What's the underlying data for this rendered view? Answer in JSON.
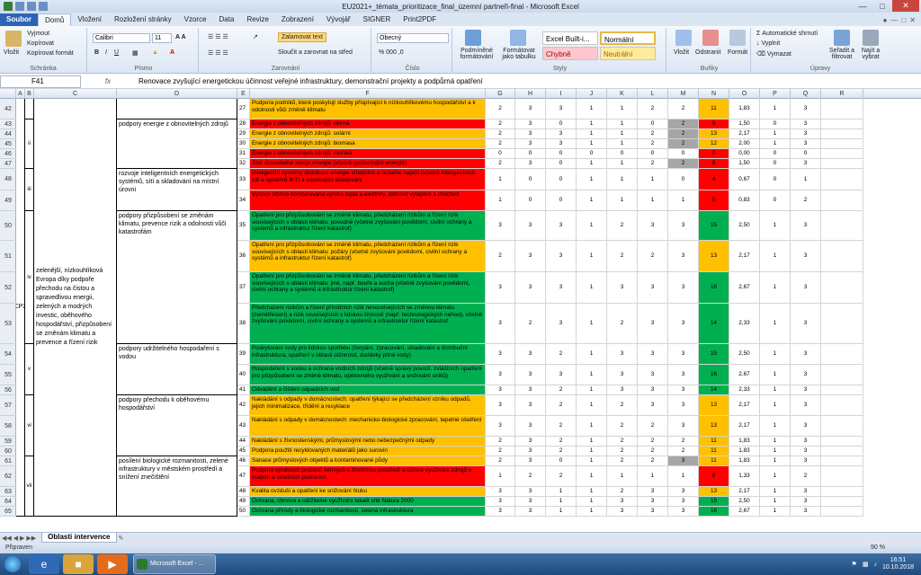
{
  "window": {
    "title": "EU2021+_témata_prioritizace_final_územní partneři-final  -  Microsoft Excel",
    "controls": [
      "minimize",
      "maximize",
      "close"
    ]
  },
  "ribbon_tabs": [
    "Soubor",
    "Domů",
    "Vložení",
    "Rozložení stránky",
    "Vzorce",
    "Data",
    "Revize",
    "Zobrazení",
    "Vývojář",
    "SIGNER",
    "Print2PDF"
  ],
  "ribbon": {
    "clipboard": {
      "paste": "Vložit",
      "cut": "Vyjmout",
      "copy": "Kopírovat",
      "format_painter": "Kopírovat formát",
      "label": "Schránka"
    },
    "font": {
      "name": "Calibri",
      "size": "11",
      "label": "Písmo"
    },
    "alignment": {
      "wrap": "Zalamovat text",
      "merge": "Sloučit a zarovnat na střed",
      "label": "Zarovnání"
    },
    "number": {
      "format": "Obecný",
      "label": "Číslo"
    },
    "styles": {
      "cond_format": "Podmíněné formátování",
      "as_table": "Formátovat jako tabulku",
      "builtin": "Excel Built-i...",
      "normal": "Normální",
      "bad": "Chybně",
      "neutral": "Neutrální",
      "label": "Styly"
    },
    "cells": {
      "insert": "Vložit",
      "delete": "Odstranit",
      "format": "Formát",
      "label": "Buňky"
    },
    "editing": {
      "autosum": "Automatické shrnutí",
      "fill": "Vyplnit",
      "clear": "Vymazat",
      "sort": "Seřadit a filtrovat",
      "find": "Najít a vybrat",
      "label": "Úpravy"
    }
  },
  "formula_bar": {
    "name_box": "F41",
    "fx": "fx",
    "content": "Renovace zvyšující energetickou účinnost veřejné infrastruktury, demonstrační projekty a podpůrná opatření"
  },
  "columns": [
    "A",
    "B",
    "C",
    "D",
    "E",
    "F",
    "G",
    "H",
    "I",
    "J",
    "K",
    "L",
    "M",
    "N",
    "O",
    "P",
    "Q",
    "R"
  ],
  "colors": {
    "green": "#00b050",
    "orange": "#ffc000",
    "red": "#ff0000",
    "grey": "#a6a6a6"
  },
  "merged_labels": {
    "cp": "CP2",
    "b_ii": "ii",
    "b_iii": "iii",
    "b_iv": "iv",
    "b_v": "v",
    "b_vi": "vi",
    "b_vii": "vii",
    "c_text": "zelenější, nízkouhlíková Evropa díky podpoře přechodu na čistou a spravedlivou energii, zelených a modrých investic, oběhového hospodářství, přizpůsobení se změnám klimatu a prevence a řízení rizik",
    "d_ii": "podpory energie z obnovitelných zdrojů",
    "d_iii": "rozvoje inteligentních energetických systémů, sítí a skladování na místní úrovni",
    "d_iv": "podpory přizpůsobení se změnám klimatu, prevence rizik a odolnosti vůči katastrofám",
    "d_v": "podpory udržitelného hospodaření s vodou",
    "d_vi": "podpory přechodu k oběhovému hospodářství",
    "d_vii": "posílení biologické rozmanitosti, zelené infrastruktury v městském prostředí a snížení znečištění"
  },
  "rows": [
    {
      "row": "42",
      "e": "27",
      "f": "Podpora podniků, které poskytují služby přispívající k nízkouhlíkovému hospodářství a k odolnosti vůči změně klimatu",
      "g": "2",
      "h": "3",
      "i": "3",
      "j": "1",
      "k": "1",
      "l": "2",
      "m": "2",
      "n": "11",
      "o": "1,83",
      "p": "1",
      "q": "3",
      "color": "orange",
      "mgrey": false
    },
    {
      "row": "43",
      "e": "28",
      "f": "Energie z obnovitelných zdrojů: větrná",
      "g": "2",
      "h": "3",
      "i": "0",
      "j": "1",
      "k": "1",
      "l": "0",
      "m": "2",
      "n": "9",
      "o": "1,50",
      "p": "0",
      "q": "3",
      "color": "red",
      "mgrey": true
    },
    {
      "row": "44",
      "e": "29",
      "f": "Energie z obnovitelných zdrojů: solární",
      "g": "2",
      "h": "3",
      "i": "3",
      "j": "1",
      "k": "1",
      "l": "2",
      "m": "2",
      "n": "13",
      "o": "2,17",
      "p": "1",
      "q": "3",
      "color": "orange",
      "mgrey": true
    },
    {
      "row": "45",
      "e": "30",
      "f": "Energie z obnovitelných zdrojů: biomasa",
      "g": "2",
      "h": "3",
      "i": "3",
      "j": "1",
      "k": "1",
      "l": "2",
      "m": "2",
      "n": "12",
      "o": "2,00",
      "p": "1",
      "q": "3",
      "color": "orange",
      "mgrey": true
    },
    {
      "row": "46",
      "e": "31",
      "f": "Energie z obnovitelných zdrojů: mořská",
      "g": "0",
      "h": "0",
      "i": "0",
      "j": "0",
      "k": "0",
      "l": "0",
      "m": "0",
      "n": "0",
      "o": "0,00",
      "p": "0",
      "q": "0",
      "color": "red",
      "mgrey": false
    },
    {
      "row": "47",
      "e": "32",
      "f": "Jiné obnovitelné zdroje energie (včetně geotermální energie)",
      "g": "2",
      "h": "3",
      "i": "0",
      "j": "1",
      "k": "1",
      "l": "2",
      "m": "2",
      "n": "9",
      "o": "1,50",
      "p": "0",
      "q": "3",
      "color": "red",
      "mgrey": true
    },
    {
      "row": "48",
      "e": "33",
      "f": "Inteligentní systémy distribuce energie středního a nízkého napětí (včetně inteligentních sítí a systémů IKT) a související skladování",
      "g": "1",
      "h": "0",
      "i": "0",
      "j": "1",
      "k": "1",
      "l": "1",
      "m": "0",
      "n": "4",
      "o": "0,67",
      "p": "0",
      "q": "1",
      "color": "red",
      "mgrey": false
    },
    {
      "row": "49",
      "e": "34",
      "f": "Vysoce účinná kombinovaná výroba tepla a elektřiny, dálkové vytápění a chlazení",
      "g": "1",
      "h": "0",
      "i": "0",
      "j": "1",
      "k": "1",
      "l": "1",
      "m": "1",
      "n": "5",
      "o": "0,83",
      "p": "0",
      "q": "2",
      "color": "red",
      "mgrey": false
    },
    {
      "row": "50",
      "e": "35",
      "f": "Opatření pro přizpůsobování se změně klimatu, předcházení rizikům a řízení rizik souvisejících s oblastí klimatu: povodně (včetně zvyšování povědomí, civilní ochrany a systémů a infrastruktur řízení katastrof)",
      "g": "3",
      "h": "3",
      "i": "3",
      "j": "1",
      "k": "2",
      "l": "3",
      "m": "3",
      "n": "15",
      "o": "2,50",
      "p": "1",
      "q": "3",
      "color": "green",
      "mgrey": false
    },
    {
      "row": "51",
      "e": "36",
      "f": "Opatření pro přizpůsobování se změně klimatu, předcházení rizikům a řízení rizik souvisejících s oblastí klimatu: požáry (včetně zvyšování povědomí, civilní ochrany a systémů a infrastruktur řízení katastrof)",
      "g": "2",
      "h": "3",
      "i": "3",
      "j": "1",
      "k": "2",
      "l": "2",
      "m": "3",
      "n": "13",
      "o": "2,17",
      "p": "1",
      "q": "3",
      "color": "orange",
      "mgrey": false
    },
    {
      "row": "52",
      "e": "37",
      "f": "Opatření pro přizpůsobování se změně klimatu, předcházení rizikům a řízení rizik souvisejících s oblastí klimatu: jiné, např. bouře a sucha (včetně zvyšování povědomí, civilní ochrany a systémů a infrastruktur řízení katastrof)",
      "g": "3",
      "h": "3",
      "i": "3",
      "j": "1",
      "k": "3",
      "l": "3",
      "m": "3",
      "n": "16",
      "o": "2,67",
      "p": "1",
      "q": "3",
      "color": "green",
      "mgrey": false
    },
    {
      "row": "53",
      "e": "38",
      "f": "Předcházení rizikům a řízení přírodních rizik nesouvisejících se změnou klimatu (zemětřesení) a rizik souvisejících s lidskou činností (např. technologických nehod), včetně zvyšování povědomí, civilní ochrany a systémů a infrastruktur řízení katastrof",
      "g": "3",
      "h": "2",
      "i": "3",
      "j": "1",
      "k": "2",
      "l": "3",
      "m": "3",
      "n": "14",
      "o": "2,33",
      "p": "1",
      "q": "3",
      "color": "green",
      "mgrey": false
    },
    {
      "row": "54",
      "e": "39",
      "f": "Poskytování vody pro lidskou spotřebu (čerpání, zpracování, skladování a distribuční infrastruktura, opatření v oblasti účinnosti, dodávky pitné vody)",
      "g": "3",
      "h": "3",
      "i": "2",
      "j": "1",
      "k": "3",
      "l": "3",
      "m": "3",
      "n": "15",
      "o": "2,50",
      "p": "1",
      "q": "3",
      "color": "green",
      "mgrey": false
    },
    {
      "row": "55",
      "e": "40",
      "f": "Hospodaření s vodou a ochrana vodních zdrojů (včetně správy povodí, zvláštních opatření pro přizpůsobení se změně klimatu, opětovného využívání a snižování úniků)",
      "g": "3",
      "h": "3",
      "i": "3",
      "j": "1",
      "k": "3",
      "l": "3",
      "m": "3",
      "n": "16",
      "o": "2,67",
      "p": "1",
      "q": "3",
      "color": "green",
      "mgrey": false
    },
    {
      "row": "56",
      "e": "41",
      "f": "Odvádění a čištění odpadních vod",
      "g": "3",
      "h": "3",
      "i": "2",
      "j": "1",
      "k": "3",
      "l": "3",
      "m": "3",
      "n": "14",
      "o": "2,33",
      "p": "1",
      "q": "3",
      "color": "green",
      "mgrey": false
    },
    {
      "row": "57",
      "e": "42",
      "f": "Nakládání s odpady v domácnostech: opatření týkající se předcházení vzniku odpadů, jejich minimalizace, třídění a recyklace",
      "g": "3",
      "h": "3",
      "i": "2",
      "j": "1",
      "k": "2",
      "l": "3",
      "m": "3",
      "n": "13",
      "o": "2,17",
      "p": "1",
      "q": "3",
      "color": "orange",
      "mgrey": false
    },
    {
      "row": "58",
      "e": "43",
      "f": "Nakládání s odpady v domácnostech: mechanicko-biologické zpracování, tepelné ošetření",
      "g": "3",
      "h": "3",
      "i": "2",
      "j": "1",
      "k": "2",
      "l": "2",
      "m": "3",
      "n": "13",
      "o": "2,17",
      "p": "1",
      "q": "3",
      "color": "orange",
      "mgrey": false
    },
    {
      "row": "59",
      "e": "44",
      "f": "Nakládání s živnostenskými, průmyslovými nebo nebezpečnými odpady",
      "g": "2",
      "h": "3",
      "i": "2",
      "j": "1",
      "k": "2",
      "l": "2",
      "m": "2",
      "n": "11",
      "o": "1,83",
      "p": "1",
      "q": "3",
      "color": "orange",
      "mgrey": false
    },
    {
      "row": "60",
      "e": "45",
      "f": "Podpora použití recyklovaných materiálů jako surovin",
      "g": "2",
      "h": "3",
      "i": "2",
      "j": "1",
      "k": "2",
      "l": "2",
      "m": "2",
      "n": "11",
      "o": "1,83",
      "p": "1",
      "q": "3",
      "color": "orange",
      "mgrey": false
    },
    {
      "row": "61",
      "e": "46",
      "f": "Sanace průmyslových objektů a kontaminované půdy",
      "g": "2",
      "h": "3",
      "i": "0",
      "j": "1",
      "k": "2",
      "l": "2",
      "m": "3",
      "n": "11",
      "o": "1,83",
      "p": "1",
      "q": "3",
      "color": "orange",
      "mgrey": true
    },
    {
      "row": "62",
      "e": "47",
      "f": "Podpora výrobních procesů šetrných k životnímu prostředí a účinné využívání zdrojů v malých a středních podnicích",
      "g": "1",
      "h": "2",
      "i": "2",
      "j": "1",
      "k": "1",
      "l": "1",
      "m": "1",
      "n": "8",
      "o": "1,33",
      "p": "1",
      "q": "2",
      "color": "red",
      "mgrey": false
    },
    {
      "row": "63",
      "e": "48",
      "f": "Kvalita ovzduší a opatření ke snižování hluku",
      "g": "3",
      "h": "3",
      "i": "1",
      "j": "1",
      "k": "2",
      "l": "3",
      "m": "3",
      "n": "13",
      "o": "2,17",
      "p": "1",
      "q": "3",
      "color": "orange",
      "mgrey": false
    },
    {
      "row": "64",
      "e": "49",
      "f": "Ochrana, obnova a udržitelné využívání lokalit sítě Natura 2000",
      "g": "3",
      "h": "3",
      "i": "1",
      "j": "1",
      "k": "3",
      "l": "3",
      "m": "3",
      "n": "15",
      "o": "2,50",
      "p": "1",
      "q": "3",
      "color": "green",
      "mgrey": false
    },
    {
      "row": "65",
      "e": "50",
      "f": "Ochrana přírody a biologické rozmanitosti, zelená infrastruktura",
      "g": "3",
      "h": "3",
      "i": "1",
      "j": "1",
      "k": "3",
      "l": "3",
      "m": "3",
      "n": "16",
      "o": "2,67",
      "p": "1",
      "q": "3",
      "color": "green",
      "mgrey": false
    }
  ],
  "sheet_tabs": [
    "Oblasti intervence"
  ],
  "status": {
    "ready": "Připraven",
    "zoom": "90 %"
  },
  "taskbar": {
    "task": "Microsoft Excel - ...",
    "time": "16:51",
    "date": "10.10.2018"
  }
}
